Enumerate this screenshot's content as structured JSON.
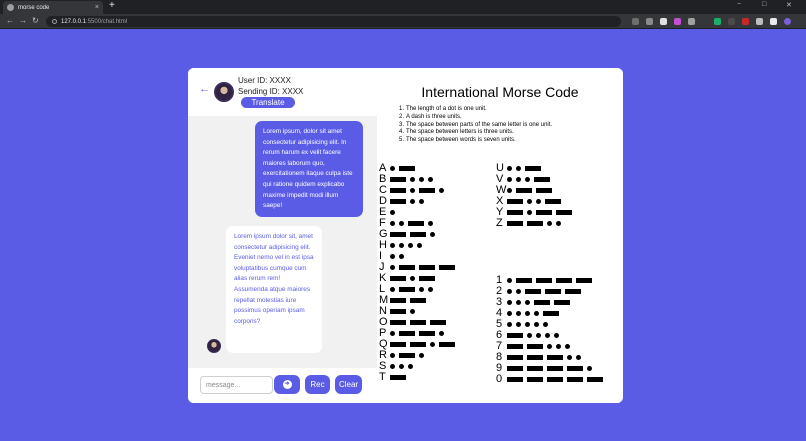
{
  "browser": {
    "tab_title": "morse code",
    "url_host": "127.0.0.1",
    "url_path": ":5500/chat.html",
    "new_tab": "+",
    "close_tab": "×",
    "minimize": "−",
    "maximize": "□",
    "close_window": "✕",
    "back": "←",
    "forward": "→",
    "reload": "↻"
  },
  "chat": {
    "back_arrow": "←",
    "user_id": "User ID: XXXX",
    "sending_id": "Sending ID: XXXX",
    "translate_label": "Translate",
    "sent_message": "Lorem ipsum, dolor sit amet consectetur adipisicing elit. In rerum harum ex velit facere maiores laborum quo, exercitationem itaque culpa iste qui ratione quidem explicabo maxime impedit modi illum saepe!",
    "received_message": "Lorem ipsum dolor sit, amet consectetur adipisicing elit. Eveniet nemo vel in est ipsa voluptatibus cumque cum alias rerum rem! Assumenda atque maiores repellat molestias iure possimus operiam ipsam corporis?",
    "input_placeholder": "message...",
    "send_icon": "➜",
    "rec_label": "Rec",
    "clear_label": "Clear"
  },
  "morse": {
    "title": "International Morse Code",
    "rules": [
      "The length of a dot is one unit.",
      "A dash is three units.",
      "The space between parts of the same letter is one unit.",
      "The space between letters is three units.",
      "The space between words is seven units."
    ],
    "letters_a_t": [
      {
        "char": "A",
        "code": ".-"
      },
      {
        "char": "B",
        "code": "-..."
      },
      {
        "char": "C",
        "code": "-.-."
      },
      {
        "char": "D",
        "code": "-.."
      },
      {
        "char": "E",
        "code": "."
      },
      {
        "char": "F",
        "code": "..-."
      },
      {
        "char": "G",
        "code": "--."
      },
      {
        "char": "H",
        "code": "...."
      },
      {
        "char": "I",
        "code": ".."
      },
      {
        "char": "J",
        "code": ".---"
      },
      {
        "char": "K",
        "code": "-.-"
      },
      {
        "char": "L",
        "code": ".-.."
      },
      {
        "char": "M",
        "code": "--"
      },
      {
        "char": "N",
        "code": "-."
      },
      {
        "char": "O",
        "code": "---"
      },
      {
        "char": "P",
        "code": ".--."
      },
      {
        "char": "Q",
        "code": "--.-"
      },
      {
        "char": "R",
        "code": ".-."
      },
      {
        "char": "S",
        "code": "..."
      },
      {
        "char": "T",
        "code": "-"
      }
    ],
    "letters_u_z": [
      {
        "char": "U",
        "code": "..-"
      },
      {
        "char": "V",
        "code": "...-"
      },
      {
        "char": "W",
        "code": ".--"
      },
      {
        "char": "X",
        "code": "-..-"
      },
      {
        "char": "Y",
        "code": "-.--"
      },
      {
        "char": "Z",
        "code": "--.."
      }
    ],
    "digits": [
      {
        "char": "1",
        "code": ".----"
      },
      {
        "char": "2",
        "code": "..---"
      },
      {
        "char": "3",
        "code": "...--"
      },
      {
        "char": "4",
        "code": "....-"
      },
      {
        "char": "5",
        "code": "....."
      },
      {
        "char": "6",
        "code": "-...."
      },
      {
        "char": "7",
        "code": "--..."
      },
      {
        "char": "8",
        "code": "---.."
      },
      {
        "char": "9",
        "code": "----."
      },
      {
        "char": "0",
        "code": "-----"
      }
    ]
  },
  "colors": {
    "accent": "#5b5ce6",
    "background": "#5b5ce6",
    "chat_bg": "#f1f1f1"
  }
}
